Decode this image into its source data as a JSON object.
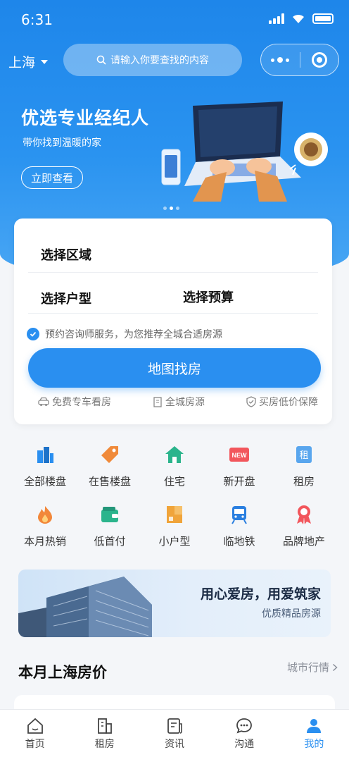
{
  "status_bar": {
    "time": "6:31"
  },
  "header": {
    "city": "上海",
    "search_placeholder": "请输入你要查找的内容"
  },
  "banner": {
    "title": "优选专业经纪人",
    "subtitle": "带你找到温暖的家",
    "button": "立即查看",
    "dots_count": 3,
    "active_dot": 1
  },
  "finder": {
    "region": "选择区域",
    "house_type": "选择户型",
    "budget": "选择预算",
    "agreement": "预约咨询师服务，为您推荐全城合适房源",
    "map_button": "地图找房",
    "perks": [
      "免费专车看房",
      "全城房源",
      "买房低价保障"
    ]
  },
  "categories": [
    {
      "label": "全部楼盘",
      "icon": "buildings-icon",
      "color": "#2a8ff0"
    },
    {
      "label": "在售楼盘",
      "icon": "price-tag-icon",
      "color": "#f08a3a"
    },
    {
      "label": "住宅",
      "icon": "house-icon",
      "color": "#2bb48c"
    },
    {
      "label": "新开盘",
      "icon": "new-badge-icon",
      "color": "#f2565c",
      "badge": "NEW"
    },
    {
      "label": "租房",
      "icon": "rent-icon",
      "color": "#59a6ee",
      "badge": "租"
    },
    {
      "label": "本月热销",
      "icon": "flame-icon",
      "color": "#f2873a"
    },
    {
      "label": "低首付",
      "icon": "wallet-icon",
      "color": "#2bb48c"
    },
    {
      "label": "小户型",
      "icon": "floorplan-icon",
      "color": "#f0a43a"
    },
    {
      "label": "临地铁",
      "icon": "subway-icon",
      "color": "#2a7fe0"
    },
    {
      "label": "品牌地产",
      "icon": "award-icon",
      "color": "#f2565c"
    }
  ],
  "promo": {
    "title": "用心爱房，用爱筑家",
    "subtitle": "优质精品房源"
  },
  "price_section": {
    "title": "本月上海房价",
    "more": "城市行情"
  },
  "tabbar": [
    {
      "label": "首页",
      "icon": "home-icon",
      "active": false
    },
    {
      "label": "租房",
      "icon": "building-icon",
      "active": false
    },
    {
      "label": "资讯",
      "icon": "news-icon",
      "active": false
    },
    {
      "label": "沟通",
      "icon": "chat-icon",
      "active": false
    },
    {
      "label": "我的",
      "icon": "user-icon",
      "active": true
    }
  ],
  "colors": {
    "primary": "#2a8ff0",
    "hero_top": "#1e86ea"
  }
}
